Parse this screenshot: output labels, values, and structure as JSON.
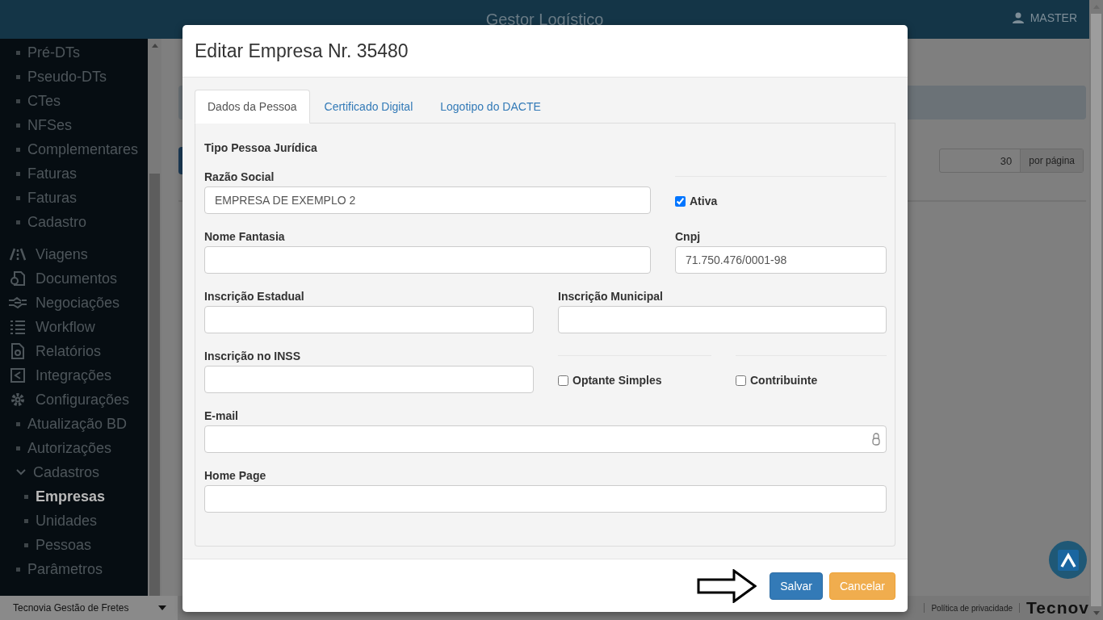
{
  "header": {
    "title": "Gestor Logístico",
    "user": "MASTER"
  },
  "sidebar": {
    "items": [
      {
        "kind": "bullet",
        "label": "Pré-DTs",
        "selected": false
      },
      {
        "kind": "bullet",
        "label": "Pseudo-DTs",
        "selected": false
      },
      {
        "kind": "bullet",
        "label": "CTes",
        "selected": false
      },
      {
        "kind": "bullet",
        "label": "NFSes",
        "selected": false
      },
      {
        "kind": "bullet",
        "label": "Complementares",
        "selected": false
      },
      {
        "kind": "bullet",
        "label": "Faturas",
        "selected": false
      },
      {
        "kind": "bullet",
        "label": "Faturas",
        "selected": false
      },
      {
        "kind": "bullet",
        "label": "Cadastro",
        "selected": false
      },
      {
        "kind": "section",
        "label": "Viagens",
        "selected": false
      },
      {
        "kind": "section",
        "label": "Documentos",
        "selected": false
      },
      {
        "kind": "section",
        "label": "Negociações",
        "selected": false
      },
      {
        "kind": "section",
        "label": "Workflow",
        "selected": false
      },
      {
        "kind": "section",
        "label": "Relatórios",
        "selected": false
      },
      {
        "kind": "section",
        "label": "Integrações",
        "selected": false
      },
      {
        "kind": "section",
        "label": "Configurações",
        "selected": false
      },
      {
        "kind": "bullet",
        "label": "Atualização BD",
        "selected": false
      },
      {
        "kind": "bullet",
        "label": "Autorizações",
        "selected": false
      },
      {
        "kind": "group",
        "label": "Cadastros",
        "selected": false,
        "expanded": true,
        "children": [
          {
            "kind": "bullet",
            "label": "Empresas",
            "selected": true
          },
          {
            "kind": "bullet",
            "label": "Unidades",
            "selected": false
          },
          {
            "kind": "bullet",
            "label": "Pessoas",
            "selected": false
          }
        ]
      },
      {
        "kind": "bullet",
        "label": "Parâmetros",
        "selected": false
      }
    ]
  },
  "page": {
    "per_page": {
      "value": "30",
      "label": "por página"
    }
  },
  "footer": {
    "product": "Tecnovia Gestão de Fretes",
    "privacy": "Política de privacidade",
    "logo": "Tecnov"
  },
  "modal": {
    "title": "Editar Empresa Nr. 35480",
    "tabs": [
      {
        "label": "Dados da Pessoa",
        "selected": true
      },
      {
        "label": "Certificado Digital",
        "selected": false
      },
      {
        "label": "Logotipo do DACTE",
        "selected": false
      }
    ],
    "person_type": "Tipo Pessoa Jurídica",
    "fields": [
      {
        "kind": "text",
        "label": "Razão Social",
        "value": "EMPRESA DE EXEMPLO 2"
      },
      {
        "kind": "checkbox",
        "label": "Ativa",
        "checked": true
      },
      {
        "kind": "text",
        "label": "Nome Fantasia"
      },
      {
        "kind": "text",
        "label": "Cnpj",
        "value": "71.750.476/0001-98"
      },
      {
        "kind": "text",
        "label": "Inscrição Estadual"
      },
      {
        "kind": "text",
        "label": "Inscrição Municipal"
      },
      {
        "kind": "text",
        "label": "Inscrição no INSS"
      },
      {
        "kind": "checkbox",
        "label": "Optante Simples",
        "checked": false
      },
      {
        "kind": "checkbox",
        "label": "Contribuinte",
        "checked": false
      },
      {
        "kind": "email",
        "label": "E-mail"
      },
      {
        "kind": "text",
        "label": "Home Page"
      }
    ],
    "buttons": [
      {
        "kind": "primary",
        "label": "Salvar"
      },
      {
        "kind": "warning",
        "label": "Cancelar"
      }
    ]
  }
}
